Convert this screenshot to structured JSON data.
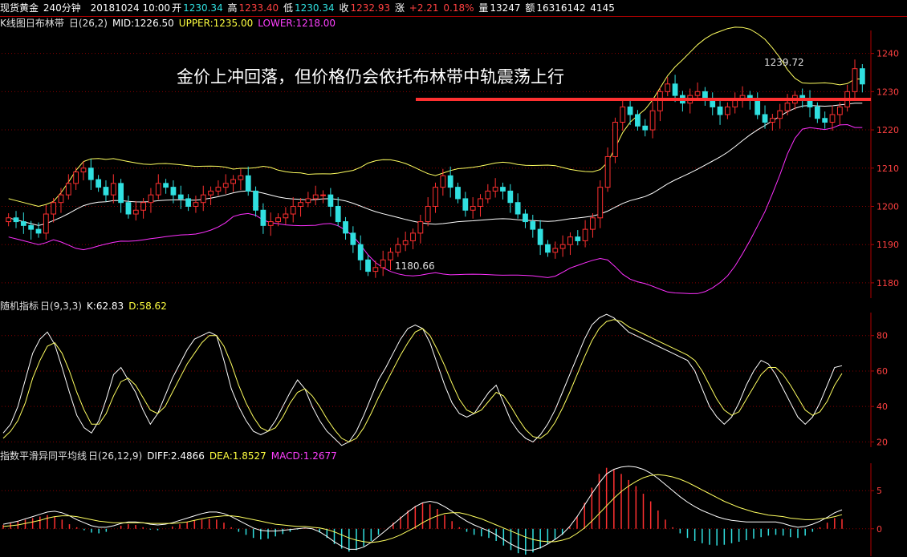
{
  "header": {
    "symbol": "现货黄金",
    "period": "240分钟",
    "datetime": "20181024 10:00",
    "open_label": "开",
    "open": "1230.34",
    "high_label": "高",
    "high": "1233.40",
    "low_label": "低",
    "low": "1230.34",
    "close_label": "收",
    "close": "1232.93",
    "change_label": "涨",
    "change": "+2.21",
    "change_pct": "0.18%",
    "volume_label": "量",
    "volume": "13247",
    "amount_label": "额",
    "amount": "16316142",
    "extra": "4145"
  },
  "main_panel": {
    "title": "K线图",
    "indicator": "日布林带",
    "indicator_params": "日(26,2)",
    "mid_label": "MID:1226.50",
    "upper_label": "UPPER:1235.00",
    "lower_label": "LOWER:1218.00",
    "annotation": "金价上冲回落，但价格仍会依托布林带中轨震荡上行",
    "high_marker": "1239.72",
    "low_marker": "1180.66"
  },
  "kdj_panel": {
    "title": "随机指标",
    "params": "日(9,3,3)",
    "k_label": "K:62.83",
    "d_label": "D:58.62"
  },
  "macd_panel": {
    "title": "指数平滑异同平均线",
    "params": "日(26,12,9)",
    "diff_label": "DIFF:2.4866",
    "dea_label": "DEA:1.8527",
    "macd_label": "MACD:1.2677"
  },
  "colors": {
    "up": "#ff3030",
    "down": "#30e0e0",
    "grid": "#880000",
    "upper": "#ffff60",
    "mid": "#ffffff",
    "lower": "#ff30ff",
    "trendline": "#ff3030"
  },
  "chart_data": [
    {
      "type": "candlestick",
      "title": "",
      "y_ticks": [
        1180,
        1190,
        1200,
        1210,
        1220,
        1230,
        1240
      ],
      "ylim": [
        1176,
        1246
      ],
      "close": [
        1197,
        1196,
        1195,
        1194,
        1193,
        1198,
        1201,
        1203,
        1206,
        1209,
        1210,
        1207,
        1205,
        1203,
        1206,
        1201,
        1198,
        1199,
        1201,
        1203,
        1206,
        1205,
        1203,
        1202,
        1200,
        1201,
        1203,
        1204,
        1205,
        1206,
        1207,
        1208,
        1204,
        1199,
        1195,
        1196,
        1197,
        1198,
        1200,
        1201,
        1202,
        1203,
        1203,
        1200,
        1196,
        1193,
        1190,
        1186,
        1183,
        1184,
        1186,
        1188,
        1190,
        1191,
        1193,
        1196,
        1200,
        1205,
        1208,
        1205,
        1202,
        1199,
        1200,
        1202,
        1204,
        1205,
        1204,
        1201,
        1198,
        1196,
        1194,
        1190,
        1188,
        1189,
        1190,
        1192,
        1191,
        1194,
        1197,
        1205,
        1213,
        1222,
        1226,
        1224,
        1221,
        1220,
        1225,
        1230,
        1232,
        1229,
        1227,
        1229,
        1230,
        1228,
        1226,
        1224,
        1226,
        1228,
        1229,
        1228,
        1224,
        1222,
        1223,
        1225,
        1227,
        1229,
        1228,
        1226,
        1223,
        1222,
        1224,
        1226,
        1230,
        1236,
        1232
      ],
      "annotations": [
        "1239.72",
        "1180.66"
      ]
    },
    {
      "type": "line",
      "title": "",
      "y_ticks": [
        20,
        40,
        60,
        80
      ],
      "ylim": [
        17,
        93
      ],
      "series": [
        {
          "name": "K",
          "values": [
            25,
            30,
            40,
            55,
            70,
            78,
            82,
            75,
            62,
            48,
            35,
            28,
            25,
            32,
            44,
            58,
            62,
            55,
            48,
            38,
            30,
            36,
            46,
            56,
            64,
            72,
            78,
            80,
            82,
            80,
            66,
            50,
            40,
            32,
            26,
            24,
            26,
            32,
            40,
            48,
            55,
            50,
            40,
            32,
            26,
            22,
            18,
            20,
            26,
            35,
            45,
            55,
            62,
            70,
            78,
            84,
            86,
            84,
            76,
            64,
            52,
            42,
            36,
            34,
            36,
            42,
            48,
            52,
            42,
            32,
            26,
            22,
            20,
            24,
            30,
            38,
            48,
            58,
            68,
            78,
            86,
            90,
            92,
            90,
            86,
            82,
            80,
            78,
            76,
            74,
            72,
            70,
            68,
            66,
            60,
            50,
            40,
            34,
            30,
            34,
            42,
            52,
            60,
            66,
            64,
            58,
            50,
            42,
            34,
            30,
            34,
            42,
            52,
            62,
            63
          ]
        },
        {
          "name": "D",
          "values": [
            22,
            26,
            32,
            42,
            56,
            66,
            74,
            76,
            70,
            60,
            48,
            38,
            30,
            30,
            36,
            46,
            54,
            56,
            52,
            45,
            38,
            36,
            40,
            48,
            56,
            64,
            70,
            76,
            80,
            80,
            74,
            64,
            52,
            42,
            34,
            28,
            26,
            28,
            34,
            42,
            48,
            50,
            46,
            40,
            33,
            27,
            22,
            20,
            22,
            28,
            36,
            45,
            53,
            61,
            69,
            76,
            82,
            84,
            80,
            72,
            63,
            53,
            44,
            38,
            36,
            38,
            43,
            48,
            46,
            40,
            33,
            27,
            23,
            22,
            25,
            31,
            39,
            48,
            58,
            68,
            77,
            84,
            88,
            89,
            88,
            85,
            83,
            81,
            79,
            77,
            75,
            73,
            71,
            69,
            66,
            60,
            52,
            44,
            38,
            35,
            37,
            44,
            51,
            58,
            62,
            62,
            58,
            52,
            45,
            38,
            35,
            37,
            43,
            52,
            58.6
          ]
        }
      ]
    },
    {
      "type": "bar",
      "title": "",
      "y_ticks": [
        0,
        5
      ],
      "ylim": [
        -3.6,
        8.6
      ],
      "histogram": [
        0.5,
        0.8,
        1.0,
        1.2,
        1.4,
        1.6,
        1.8,
        1.6,
        1.2,
        0.6,
        0.2,
        -0.2,
        -0.5,
        -0.6,
        -0.4,
        0.0,
        0.4,
        0.6,
        0.5,
        0.2,
        -0.1,
        -0.2,
        0.0,
        0.3,
        0.6,
        0.9,
        1.1,
        1.2,
        1.3,
        1.2,
        0.8,
        0.2,
        -0.4,
        -0.8,
        -1.2,
        -1.4,
        -1.3,
        -1.0,
        -0.7,
        -0.4,
        -0.1,
        0.1,
        0.0,
        -0.5,
        -1.2,
        -2.0,
        -2.6,
        -3.0,
        -2.8,
        -2.3,
        -1.6,
        -0.8,
        0.0,
        0.8,
        1.6,
        2.4,
        3.0,
        3.4,
        3.2,
        2.6,
        1.8,
        1.0,
        0.2,
        -0.4,
        -0.8,
        -1.0,
        -1.2,
        -1.6,
        -2.2,
        -2.8,
        -3.2,
        -3.4,
        -3.1,
        -2.6,
        -2.0,
        -1.4,
        -0.8,
        0.2,
        1.6,
        3.4,
        5.4,
        7.2,
        8.0,
        7.8,
        7.2,
        6.4,
        5.6,
        4.6,
        3.6,
        2.4,
        1.2,
        0.2,
        -0.6,
        -1.2,
        -1.6,
        -1.9,
        -2.1,
        -2.2,
        -2.1,
        -1.9,
        -1.7,
        -1.5,
        -1.3,
        -1.1,
        -0.9,
        -0.8,
        -0.9,
        -1.1,
        -1.2,
        -0.9,
        -0.4,
        0.2,
        0.8,
        1.4,
        1.27
      ],
      "series": [
        {
          "name": "DIFF",
          "values": [
            0.6,
            0.8,
            1.0,
            1.3,
            1.6,
            1.9,
            2.2,
            2.3,
            2.1,
            1.7,
            1.2,
            0.8,
            0.4,
            0.2,
            0.2,
            0.4,
            0.7,
            0.9,
            0.9,
            0.8,
            0.6,
            0.5,
            0.6,
            0.8,
            1.1,
            1.4,
            1.7,
            2.0,
            2.2,
            2.2,
            2.0,
            1.6,
            1.1,
            0.6,
            0.1,
            -0.2,
            -0.3,
            -0.3,
            -0.2,
            -0.1,
            0.0,
            0.1,
            0.0,
            -0.4,
            -1.0,
            -1.7,
            -2.3,
            -2.7,
            -2.7,
            -2.4,
            -1.8,
            -1.0,
            -0.2,
            0.6,
            1.4,
            2.2,
            2.9,
            3.4,
            3.6,
            3.4,
            2.9,
            2.3,
            1.6,
            1.0,
            0.5,
            0.1,
            -0.3,
            -0.8,
            -1.4,
            -2.0,
            -2.5,
            -2.8,
            -2.8,
            -2.5,
            -2.0,
            -1.4,
            -0.7,
            0.3,
            1.6,
            3.1,
            4.6,
            6.0,
            7.2,
            7.8,
            8.1,
            8.2,
            8.1,
            7.8,
            7.3,
            6.6,
            5.8,
            5.0,
            4.2,
            3.5,
            2.9,
            2.4,
            2.0,
            1.6,
            1.3,
            1.1,
            1.0,
            0.9,
            0.9,
            0.9,
            0.9,
            0.9,
            0.7,
            0.4,
            0.2,
            0.3,
            0.6,
            1.0,
            1.5,
            2.1,
            2.49
          ]
        },
        {
          "name": "DEA",
          "values": [
            0.3,
            0.4,
            0.5,
            0.7,
            0.9,
            1.1,
            1.4,
            1.6,
            1.7,
            1.7,
            1.6,
            1.4,
            1.2,
            1.0,
            0.9,
            0.8,
            0.8,
            0.8,
            0.8,
            0.8,
            0.7,
            0.7,
            0.7,
            0.7,
            0.8,
            0.9,
            1.1,
            1.3,
            1.5,
            1.6,
            1.7,
            1.7,
            1.6,
            1.4,
            1.2,
            1.0,
            0.8,
            0.6,
            0.5,
            0.4,
            0.3,
            0.3,
            0.2,
            0.1,
            -0.1,
            -0.4,
            -0.8,
            -1.2,
            -1.5,
            -1.7,
            -1.8,
            -1.7,
            -1.5,
            -1.2,
            -0.8,
            -0.3,
            0.2,
            0.8,
            1.3,
            1.7,
            2.0,
            2.1,
            2.1,
            1.9,
            1.6,
            1.3,
            0.9,
            0.5,
            0.1,
            -0.3,
            -0.7,
            -1.1,
            -1.4,
            -1.6,
            -1.7,
            -1.7,
            -1.5,
            -1.2,
            -0.6,
            0.1,
            1.0,
            2.0,
            3.0,
            4.0,
            4.9,
            5.6,
            6.2,
            6.7,
            7.0,
            7.1,
            7.0,
            6.8,
            6.5,
            6.1,
            5.6,
            5.1,
            4.6,
            4.1,
            3.6,
            3.2,
            2.8,
            2.5,
            2.2,
            2.0,
            1.8,
            1.7,
            1.6,
            1.4,
            1.3,
            1.2,
            1.2,
            1.3,
            1.4,
            1.6,
            1.85
          ]
        }
      ]
    }
  ]
}
